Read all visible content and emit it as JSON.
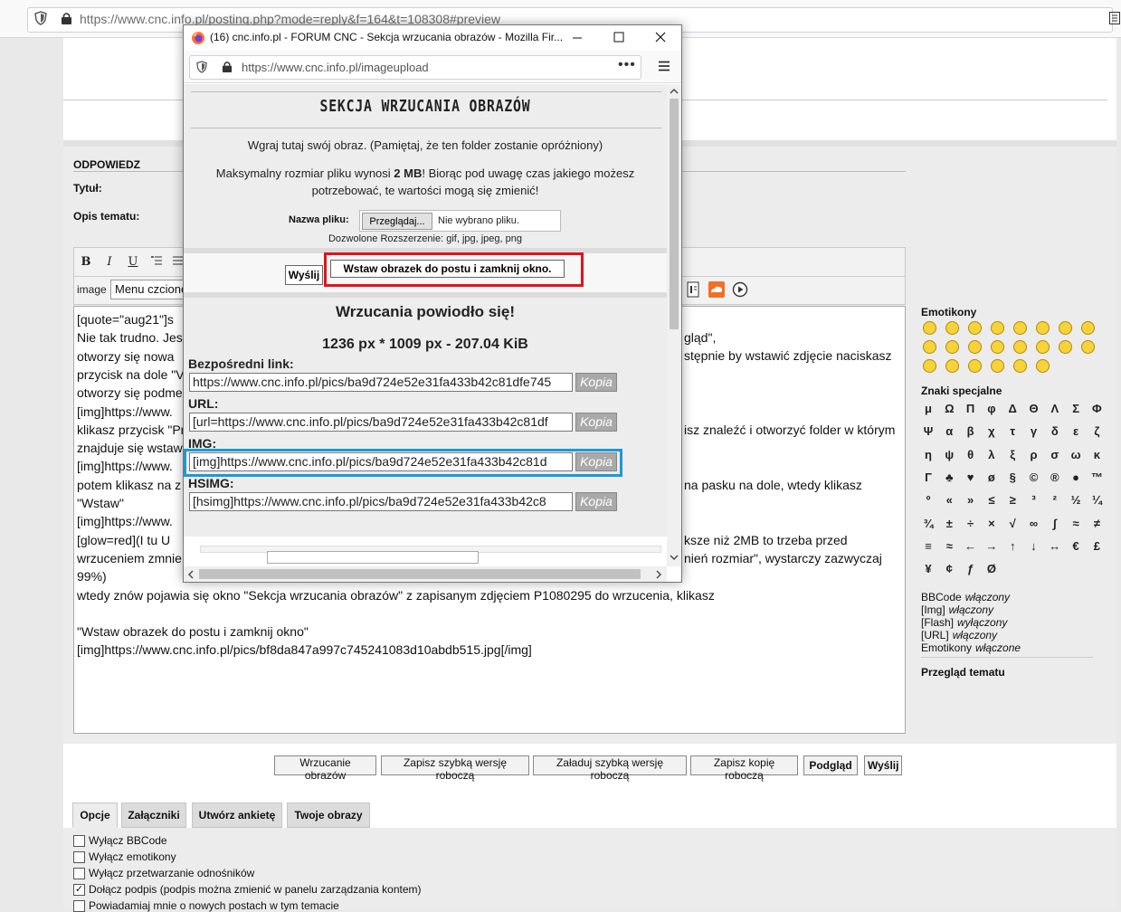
{
  "browser": {
    "url": "https://www.cnc.info.pl/posting.php?mode=reply&f=164&t=108308#preview"
  },
  "forum": {
    "section_title": "ODPOWIEDZ",
    "title_label": "Tytuł:",
    "desc_label": "Opis tematu:",
    "toolbar": {
      "bold": "B",
      "italic": "I",
      "underline": "U",
      "image_label": "image",
      "font_select": "Menu czcionek"
    },
    "editor_lines": [
      "[quote=\"aug21\"]s",
      "Nie tak trudno. Jes",
      "otworzy się nowa",
      "przycisk na dole \"V",
      "otworzy się podme",
      "[img]https://www.",
      "klikasz przycisk \"Pr",
      "znajduje się wstaw",
      "[img]https://www.",
      "potem klikasz na z",
      "\"Wstaw\"",
      "[img]https://www.",
      "[glow=red](I tu U",
      "wrzuceniem zmnie",
      "99%)",
      "wtedy znów pojawia się okno \"Sekcja wrzucania obrazów\" z zapisanym zdjęciem P1080295 do wrzucenia, klikasz",
      "",
      "\"Wstaw obrazek do postu i zamknij okno\"",
      "[img]https://www.cnc.info.pl/pics/bf8da847a997c745241083d10abdb515.jpg[/img]"
    ],
    "editor_right": [
      "gląd\",",
      "stępnie by wstawić zdjęcie naciskasz",
      "isz znaleźć i otworzyć folder w którym",
      "na pasku na dole, wtedy klikasz",
      "ksze niż 2MB to trzeba przed",
      "nień rozmiar\", wystarczy zazwyczaj"
    ],
    "emoticons_title": "Emotikony",
    "special_title": "Znaki specjalne",
    "special_chars": [
      "μ",
      "Ω",
      "Π",
      "φ",
      "Δ",
      "Θ",
      "Λ",
      "Σ",
      "Φ",
      "Ψ",
      "α",
      "β",
      "χ",
      "τ",
      "γ",
      "δ",
      "ε",
      "ζ",
      "η",
      "ψ",
      "θ",
      "λ",
      "ξ",
      "ρ",
      "σ",
      "ω",
      "κ",
      "Γ",
      "♣",
      "♥",
      "ø",
      "§",
      "©",
      "®",
      "●",
      "™",
      "º",
      "«",
      "»",
      "≤",
      "≥",
      "³",
      "²",
      "½",
      "¼",
      "¾",
      "±",
      "÷",
      "×",
      "√",
      "∞",
      "∫",
      "≈",
      "≠",
      "≡",
      "≈",
      "←",
      "→",
      "↑",
      "↓",
      "↔",
      "€",
      "£",
      "¥",
      "¢",
      "ƒ",
      "Ø"
    ],
    "status": [
      {
        "name": "BBCode",
        "state": "włączony"
      },
      {
        "name": "[Img]",
        "state": "włączony"
      },
      {
        "name": "[Flash]",
        "state": "wyłączony"
      },
      {
        "name": "[URL]",
        "state": "włączony"
      },
      {
        "name": "Emotikony",
        "state": "włączone"
      }
    ],
    "review_title": "Przegląd tematu",
    "buttons": [
      "Wrzucanie obrazów",
      "Zapisz szybką wersję roboczą",
      "Załaduj szybką wersję roboczą",
      "Zapisz kopię roboczą",
      "Podgląd",
      "Wyślij"
    ],
    "tabs": [
      "Opcje",
      "Załączniki",
      "Utwórz ankietę",
      "Twoje obrazy"
    ],
    "options": [
      {
        "label": "Wyłącz BBCode",
        "checked": false
      },
      {
        "label": "Wyłącz emotikony",
        "checked": false
      },
      {
        "label": "Wyłącz przetwarzanie odnośników",
        "checked": false
      },
      {
        "label": "Dołącz podpis (podpis można zmienić w panelu zarządzania kontem)",
        "checked": true
      },
      {
        "label": "Powiadamiaj mnie o nowych postach w tym temacie",
        "checked": false
      }
    ]
  },
  "popup": {
    "window_title": "(16) cnc.info.pl - FORUM CNC - Sekcja wrzucania obrazów - Mozilla Fir...",
    "url": "https://www.cnc.info.pl/imageupload",
    "heading": "SEKCJA WRZUCANIA OBRAZÓW",
    "intro": "Wgraj tutaj swój obraz. (Pamiętaj, że ten folder zostanie opróżniony)",
    "max_size_pre": "Maksymalny rozmiar pliku wynosi ",
    "max_size_value": "2 MB",
    "max_size_post": "! Biorąc pod uwagę czas jakiego możesz",
    "max_size_line2": "potrzebować, te wartości mogą się zmienić!",
    "file_label": "Nazwa pliku:",
    "browse_button": "Przeglądaj...",
    "no_file": "Nie wybrano pliku.",
    "allowed": "Dozwolone Rozszerzenie:  gif, jpg, jpeg, png",
    "send_button": "Wyślij",
    "insert_button": "Wstaw obrazek do postu i zamknij okno.",
    "success": "Wrzucania powiodło się!",
    "dimensions": "1236 px * 1009 px - 207.04 KiB",
    "fields": [
      {
        "label": "Bezpośredni link:",
        "value": "https://www.cnc.info.pl/pics/ba9d724e52e31fa433b42c81dfe745",
        "copy": "Kopia"
      },
      {
        "label": "URL:",
        "value": "[url=https://www.cnc.info.pl/pics/ba9d724e52e31fa433b42c81df",
        "copy": "Kopia"
      },
      {
        "label": "IMG:",
        "value": "[img]https://www.cnc.info.pl/pics/ba9d724e52e31fa433b42c81d",
        "copy": "Kopia"
      },
      {
        "label": "HSIMG:",
        "value": "[hsimg]https://www.cnc.info.pl/pics/ba9d724e52e31fa433b42c8",
        "copy": "Kopia"
      }
    ],
    "highlight_colors": {
      "insert": "#e0141e",
      "img": "#1a9ad6"
    }
  }
}
